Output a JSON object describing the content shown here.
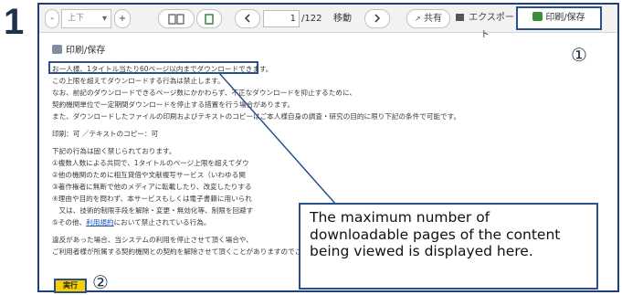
{
  "step": "1",
  "toolbar": {
    "minus": "-",
    "zoom_value": "上下",
    "plus": "+",
    "page_current": "1",
    "page_total": "/122",
    "move_label": "移動",
    "share_label": "共有",
    "export_label": "エクスポート",
    "print_label": "印刷/保存"
  },
  "marker_1": "①",
  "marker_2": "②",
  "content": {
    "heading": "印刷/保存",
    "lines": [
      "お一人様、1タイトル当たり60ページ以内までダウンロードできます。",
      "この上限を超えてダウンロードする行為は禁止します。",
      "なお、前記のダウンロードできるページ数にかかわらず、不正なダウンロードを抑止するために、",
      "契約機関単位で一定期間ダウンロードを停止する措置を行う場合があります。",
      "また、ダウンロードしたファイルの印刷およびテキストのコピーはご本人様自身の調査・研究の目的に限り下記の条件で可能です。",
      "印刷：可 ／テキストのコピー：可",
      "下記の行為は固く禁じられております。",
      "①複数人数による共同で、1タイトルのページ上限を超えてダウ",
      "②他の機関のために相互貸借や文献複写サービス（いわゆる関",
      "③著作権者に無断で他のメディアに転載したり、改変したりする",
      "④理由や目的を問わず、本サービスもしくは電子書籍に用いられ",
      "　又は、技術的制限手段を解除・変更・無効化等、制限を回避す",
      "において禁止されている行為。",
      "違反があった場合、当システムの利用を停止させて頂く場合や、",
      "ご利用者様が所属する契約機関との契約を解除させて頂くことがありますのでご注意ください。"
    ],
    "other_prefix": "⑤その他、",
    "terms_link": "利用規約"
  },
  "execute_label": "実行",
  "callout_text": "The maximum number of downloadable pages of the content being viewed is displayed here.",
  "colors": {
    "accent": "#2c4f8f",
    "execute_button": "#f4d000",
    "print_icon": "#3a8f3a"
  }
}
